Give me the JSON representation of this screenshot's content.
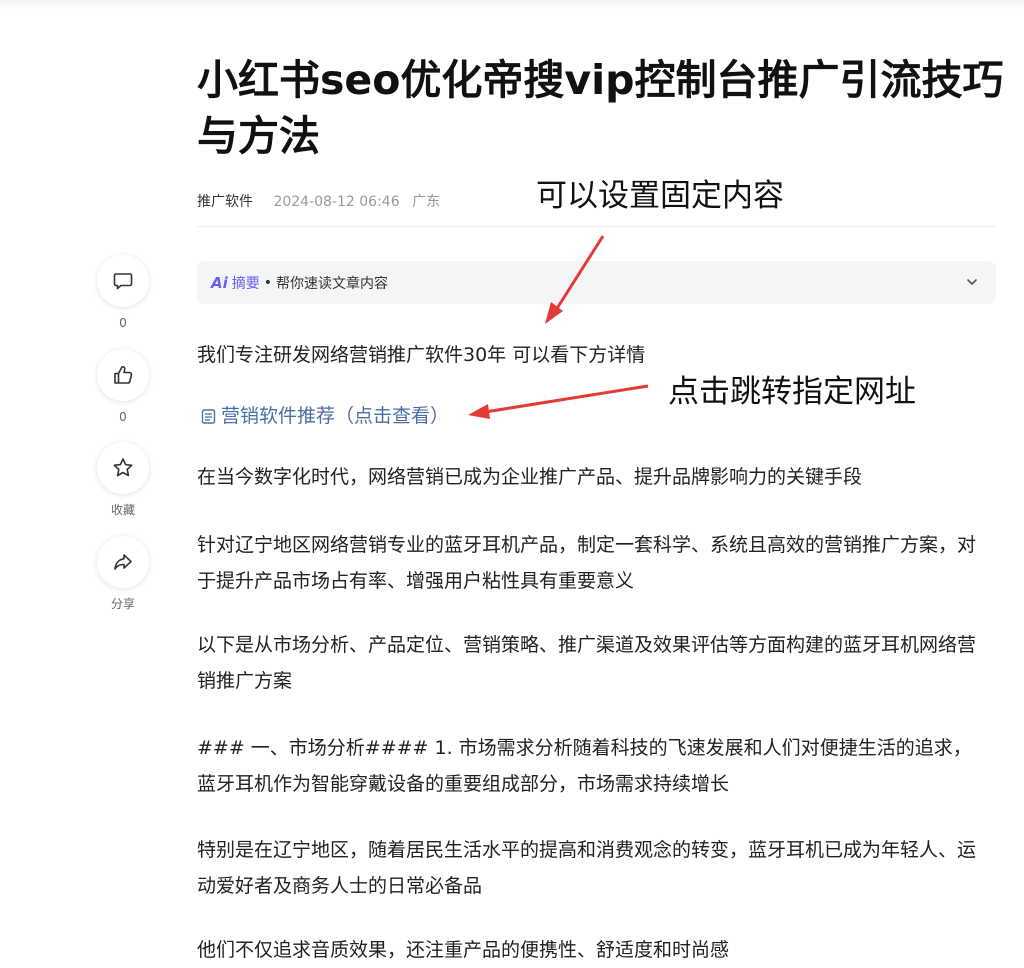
{
  "article": {
    "title": "小红书seo优化帝搜vip控制台推广引流技巧与方法",
    "author": "推广软件",
    "date": "2024-08-12 06:46",
    "location": "广东"
  },
  "summary": {
    "ai_logo": "Ai",
    "label": "摘要",
    "dot": "•",
    "description": "帮你速读文章内容"
  },
  "sidebar": {
    "comment_count": "0",
    "like_count": "0",
    "favorite_label": "收藏",
    "share_label": "分享"
  },
  "body": {
    "intro": "我们专注研发网络营销推广软件30年 可以看下方详情",
    "link_text": "营销软件推荐（点击查看）",
    "paragraphs": [
      "在当今数字化时代，网络营销已成为企业推广产品、提升品牌影响力的关键手段",
      "针对辽宁地区网络营销专业的蓝牙耳机产品，制定一套科学、系统且高效的营销推广方案，对于提升产品市场占有率、增强用户粘性具有重要意义",
      "以下是从市场分析、产品定位、营销策略、推广渠道及效果评估等方面构建的蓝牙耳机网络营销推广方案",
      "### 一、市场分析#### 1. 市场需求分析随着科技的飞速发展和人们对便捷生活的追求，蓝牙耳机作为智能穿戴设备的重要组成部分，市场需求持续增长",
      "特别是在辽宁地区，随着居民生活水平的提高和消费观念的转变，蓝牙耳机已成为年轻人、运动爱好者及商务人士的日常必备品",
      "他们不仅追求音质效果，还注重产品的便携性、舒适度和时尚感"
    ]
  },
  "annotations": {
    "fixed_content": "可以设置固定内容",
    "jump_url": "点击跳转指定网址"
  },
  "colors": {
    "accent": "#6b5cf6",
    "link": "#4a6fa5",
    "arrow": "#e53935"
  }
}
